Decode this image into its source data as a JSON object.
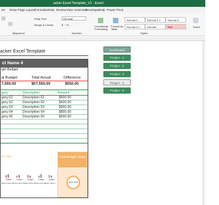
{
  "window": {
    "title": "acker Excel Template_V1  -  Excel"
  },
  "menu": {
    "tabs": [
      "ert",
      "Draw",
      "Page Layout",
      "Formulas",
      "Data",
      "Review",
      "View",
      "Automate",
      "Developer",
      "Help",
      "Power Pivot"
    ]
  },
  "ribbon": {
    "wrap_text": "Wrap Text",
    "merge_center": "Merge & Center",
    "number_format": "General",
    "conditional_formatting": "Conditional Formatting",
    "format_as_table": "Format as Table",
    "alignment_label": "Alignment",
    "number_label": "Number",
    "styles_label": "Styles",
    "insert_label": "Insert",
    "styles": [
      "Normal 2",
      "Normal 2 2",
      "Normal 3",
      "Normal 3 2",
      "Normal",
      "Bad"
    ]
  },
  "sheet": {
    "title": "acker Excel Template",
    "project_name": "ct Name 4",
    "budget_page": "get Budget",
    "summary": {
      "total_budget_label": "al Budget",
      "total_actual_label": "Total Actual",
      "difference_label": "Difference",
      "total_budget": "7,000.00",
      "total_actual": "$57,550.00",
      "difference": "$550.00"
    },
    "table": {
      "headers": [
        "gory",
        "Description",
        "Amount"
      ],
      "rows": [
        [
          "gory 61",
          "Description 61",
          "$500.00"
        ],
        [
          "gory 62",
          "Description 62",
          "$420.00"
        ],
        [
          "gory 63",
          "Description 63",
          "$900.00"
        ],
        [
          "gory 64",
          "Description 64",
          "$800.00"
        ],
        [
          "gory 65",
          "Description 65",
          "$500.00"
        ]
      ]
    },
    "mini_chart_label": "et Chart",
    "mini_chart_xlabels": [
      "Other",
      "Other",
      "Other",
      "Other",
      "Other"
    ],
    "mini_chart_sublabels": [
      "(Expensive)",
      "(Expensive)",
      "(Expensive)",
      "(Expensive)",
      "(Expensive)"
    ],
    "budget_card": {
      "title": "Total Budget Usage",
      "value": "101.0%"
    }
  },
  "nav_buttons": [
    {
      "label": "Dashboard",
      "color": "#7fa39a"
    },
    {
      "label": "Project - 1",
      "color": "#3d8b5a"
    },
    {
      "label": "Project - 2",
      "color": "#3d8b5a"
    },
    {
      "label": "Project - 3",
      "color": "#3d8b5a"
    },
    {
      "label": "Project - 4",
      "color": "#d9d9d9"
    },
    {
      "label": "Project - 5",
      "color": "#3d8b5a"
    }
  ]
}
